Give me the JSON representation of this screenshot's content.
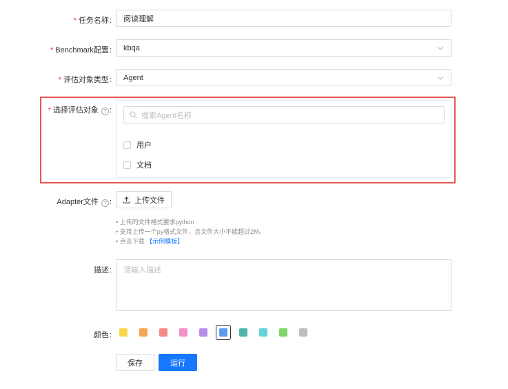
{
  "form": {
    "task_name": {
      "label": "任务名称",
      "value": "阅读理解",
      "required": true
    },
    "benchmark": {
      "label": "Benchmark配置",
      "value": "kbqa",
      "required": true
    },
    "target_type": {
      "label": "评估对象类型",
      "value": "Agent",
      "required": true
    },
    "target_select": {
      "label": "选择评估对象",
      "required": true,
      "help": "?",
      "search_placeholder": "搜索Agent名称",
      "options": [
        {
          "label": "用户",
          "checked": false
        },
        {
          "label": "文档",
          "checked": false
        }
      ]
    },
    "adapter": {
      "label": "Adapter文件",
      "help": "?",
      "upload_label": "上传文件",
      "hints": [
        "• 上传的文件格式要求python",
        "• 支持上传一个py格式文件，且文件大小不能超过2M。",
        "• 点击下载 "
      ],
      "template_link": "【示例模板】"
    },
    "description": {
      "label": "描述",
      "placeholder": "请输入描述"
    },
    "color": {
      "label": "颜色",
      "selected_index": 5,
      "options": [
        "#f8d84a",
        "#f5a550",
        "#f28b82",
        "#f48fc8",
        "#b98be8",
        "#5b9cf0",
        "#4db6ac",
        "#5fd3d6",
        "#7ed36a",
        "#bdbdbd"
      ]
    },
    "buttons": {
      "save": "保存",
      "run": "运行"
    },
    "colon": ":",
    "required_mark": "*"
  },
  "colors": {
    "primary": "#1677ff",
    "highlight": "#e9574c",
    "required": "#f5222d"
  }
}
